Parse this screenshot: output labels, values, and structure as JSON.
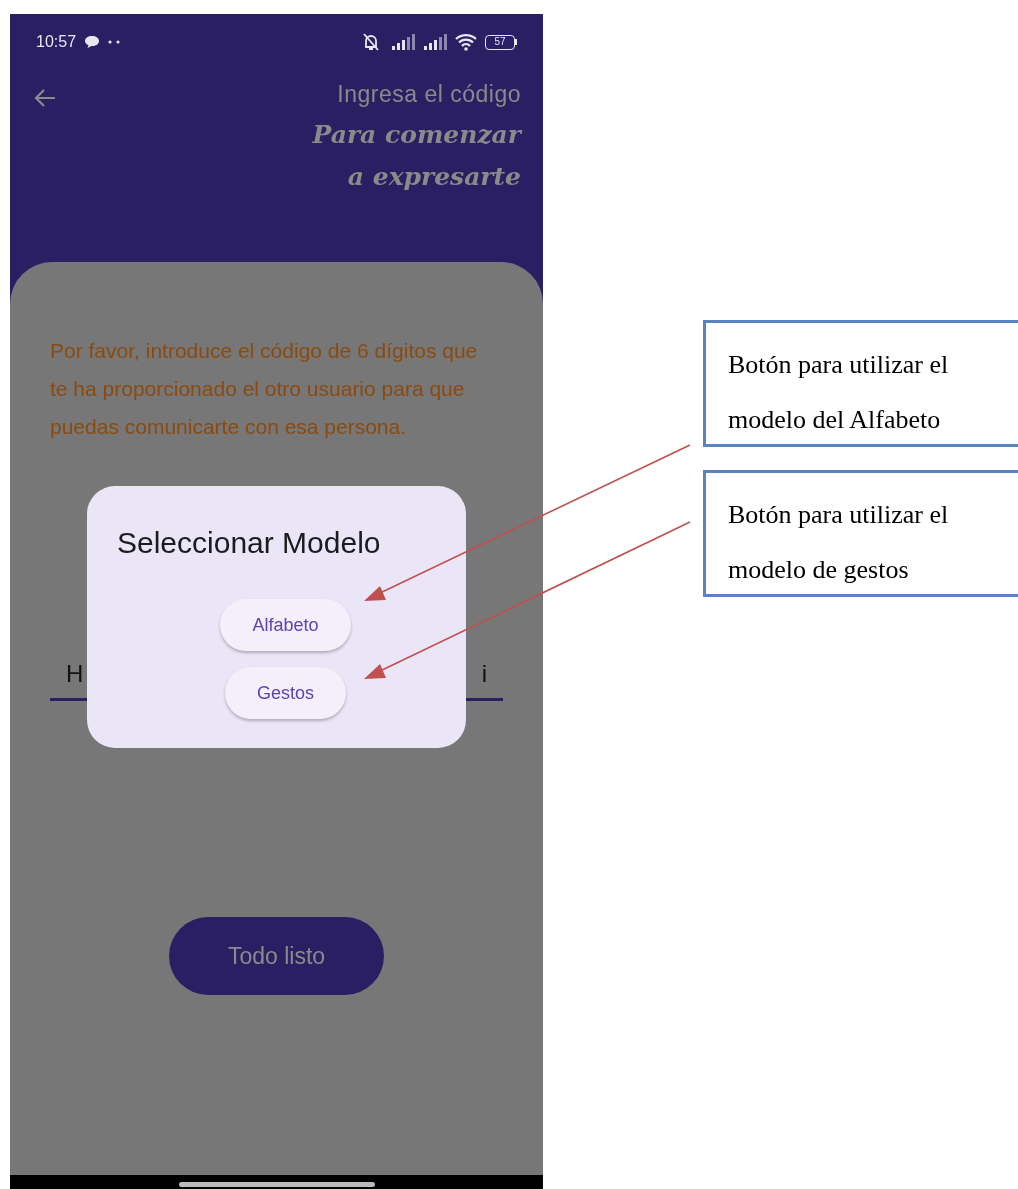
{
  "status_bar": {
    "time": "10:57",
    "battery": "57"
  },
  "header": {
    "title": "Ingresa el código",
    "subtitle_lines": [
      "Para comenzar",
      "a expresarte"
    ]
  },
  "instructions": "Por favor, introduce el código de 6 dígitos que te ha proporcionado el otro usuario para que puedas comunicarte con esa persona.",
  "code_field": {
    "visible_start": "H",
    "visible_end": "i"
  },
  "primary_button": "Todo listo",
  "dialog": {
    "title": "Seleccionar Modelo",
    "buttons": [
      "Alfabeto",
      "Gestos"
    ]
  },
  "annotations": [
    {
      "text": "Botón para utilizar el modelo del Alfabeto"
    },
    {
      "text": "Botón para utilizar el modelo de gestos"
    }
  ]
}
